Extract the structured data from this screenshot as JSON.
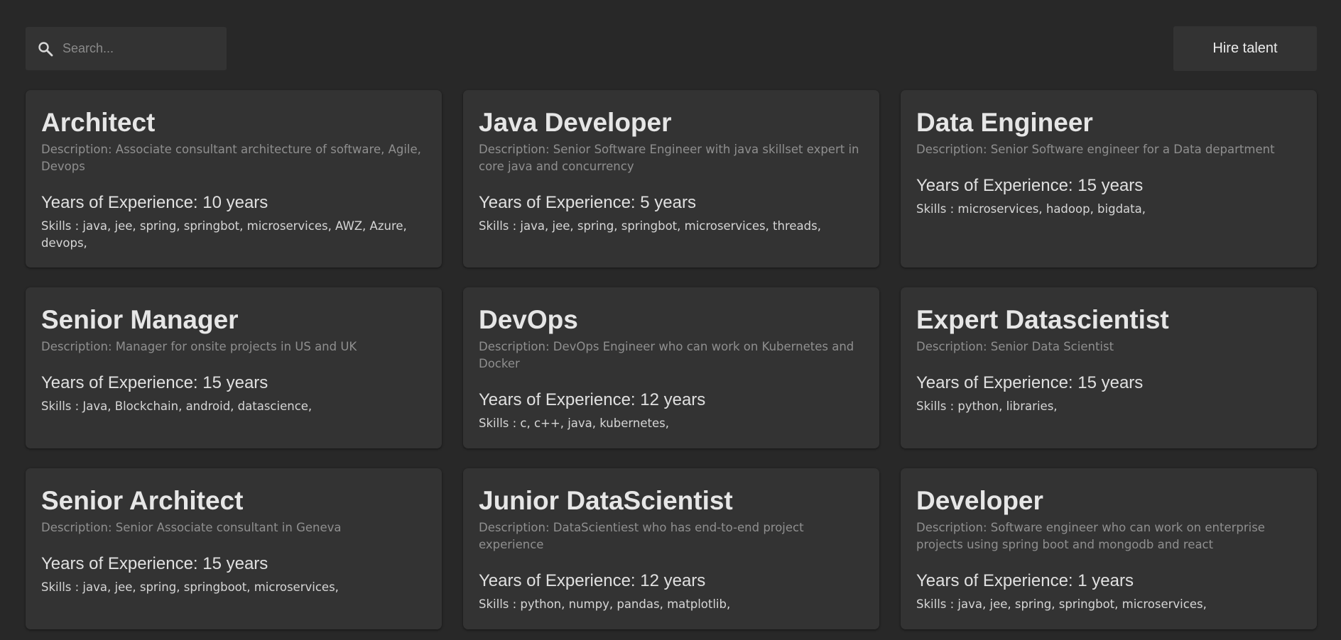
{
  "search": {
    "placeholder": "Search..."
  },
  "header": {
    "hire_label": "Hire talent"
  },
  "labels": {
    "description_prefix": "Description: ",
    "experience_prefix": "Years of Experience: ",
    "experience_suffix": " years",
    "skills_prefix": "Skills : "
  },
  "cards": [
    {
      "title": "Architect",
      "description": "Description: Associate consultant architecture of software, Agile, Devops",
      "experience": "Years of Experience: 10 years",
      "skills": "Skills : java, jee, spring, springbot, microservices, AWZ, Azure, devops,"
    },
    {
      "title": "Java Developer",
      "description": "Description: Senior Software Engineer with java skillset expert in core java and concurrency",
      "experience": "Years of Experience: 5 years",
      "skills": "Skills : java, jee, spring, springbot, microservices, threads,"
    },
    {
      "title": "Data Engineer",
      "description": "Description: Senior Software engineer for a Data department",
      "experience": "Years of Experience: 15 years",
      "skills": "Skills : microservices, hadoop, bigdata,"
    },
    {
      "title": "Senior Manager",
      "description": "Description: Manager for onsite projects in US and UK",
      "experience": "Years of Experience: 15 years",
      "skills": "Skills : Java, Blockchain, android, datascience,"
    },
    {
      "title": "DevOps",
      "description": "Description: DevOps Engineer who can work on Kubernetes and Docker",
      "experience": "Years of Experience: 12 years",
      "skills": "Skills : c, c++, java, kubernetes,"
    },
    {
      "title": "Expert Datascientist",
      "description": "Description: Senior Data Scientist",
      "experience": "Years of Experience: 15 years",
      "skills": "Skills : python, libraries,"
    },
    {
      "title": "Senior Architect",
      "description": "Description: Senior Associate consultant in Geneva",
      "experience": "Years of Experience: 15 years",
      "skills": "Skills : java, jee, spring, springboot, microservices,"
    },
    {
      "title": "Junior DataScientist",
      "description": "Description: DataScientiest who has end-to-end project experience",
      "experience": "Years of Experience: 12 years",
      "skills": "Skills : python, numpy, pandas, matplotlib,"
    },
    {
      "title": "Developer",
      "description": "Description: Software engineer who can work on enterprise projects using spring boot and mongodb and react",
      "experience": "Years of Experience: 1 years",
      "skills": "Skills : java, jee, spring, springbot, microservices,"
    }
  ],
  "colors": {
    "background": "#282828",
    "surface": "#333333",
    "title": "#e6e6e6",
    "description": "#8f8f8f"
  },
  "icons": {
    "search": "search-icon"
  }
}
